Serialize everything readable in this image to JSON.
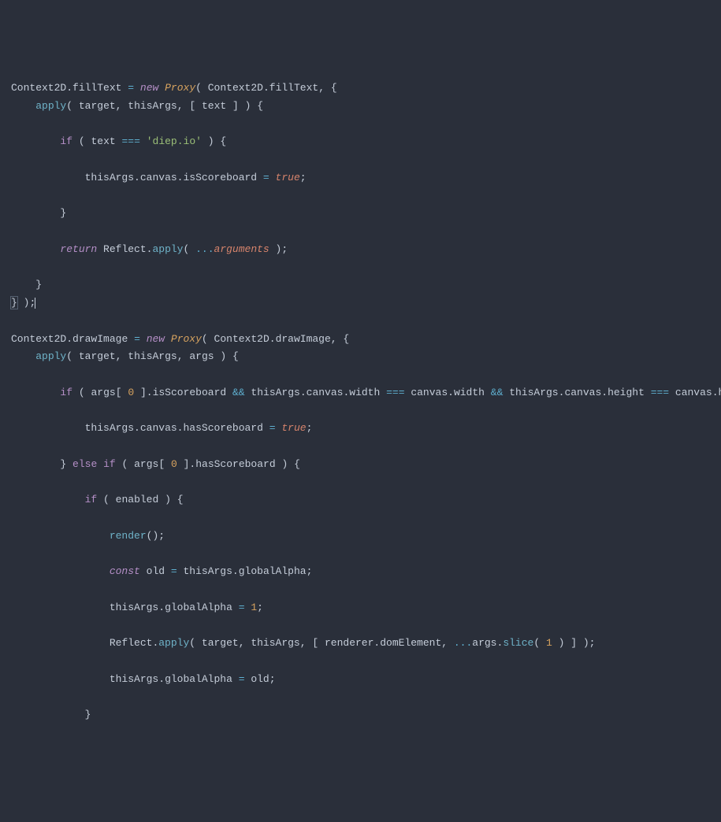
{
  "code": {
    "l1": {
      "a": "Context2D",
      "b": "fillText",
      "c": "new",
      "d": "Proxy",
      "e": "Context2D",
      "f": "fillText"
    },
    "l2": {
      "a": "apply",
      "b": "target",
      "c": "thisArgs",
      "d": "text"
    },
    "l4": {
      "a": "if",
      "b": "text",
      "c": "===",
      "d": "'diep.io'"
    },
    "l6": {
      "a": "thisArgs",
      "b": "canvas",
      "c": "isScoreboard",
      "d": "=",
      "e": "true"
    },
    "l10": {
      "a": "return",
      "b": "Reflect",
      "c": "apply",
      "d": "...",
      "e": "arguments"
    },
    "l14": {
      "a": "Context2D",
      "b": "drawImage",
      "c": "new",
      "d": "Proxy",
      "e": "Context2D",
      "f": "drawImage"
    },
    "l15": {
      "a": "apply",
      "b": "target",
      "c": "thisArgs",
      "d": "args"
    },
    "l17": {
      "a": "if",
      "b": "args",
      "c": "0",
      "d": "isScoreboard",
      "e": "&&",
      "f": "thisArgs",
      "g": "canvas",
      "h": "width",
      "i": "===",
      "j": "canvas",
      "k": "width",
      "l": "&&",
      "m": "thisArgs",
      "n": "canvas",
      "o": "height",
      "p": "===",
      "q": "canvas",
      "r": "height"
    },
    "l19": {
      "a": "thisArgs",
      "b": "canvas",
      "c": "hasScoreboard",
      "d": "=",
      "e": "true"
    },
    "l21": {
      "a": "else",
      "b": "if",
      "c": "args",
      "d": "0",
      "e": "hasScoreboard"
    },
    "l23": {
      "a": "if",
      "b": "enabled"
    },
    "l25": {
      "a": "render"
    },
    "l27": {
      "a": "const",
      "b": "old",
      "c": "=",
      "d": "thisArgs",
      "e": "globalAlpha"
    },
    "l29": {
      "a": "thisArgs",
      "b": "globalAlpha",
      "c": "=",
      "d": "1"
    },
    "l31": {
      "a": "Reflect",
      "b": "apply",
      "c": "target",
      "d": "thisArgs",
      "e": "renderer",
      "f": "domElement",
      "g": "...",
      "h": "args",
      "i": "slice",
      "j": "1"
    },
    "l33": {
      "a": "thisArgs",
      "b": "globalAlpha",
      "c": "=",
      "d": "old"
    }
  }
}
